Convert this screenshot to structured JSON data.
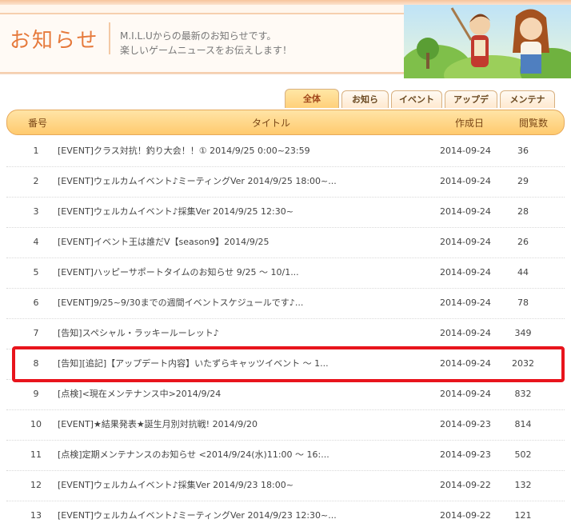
{
  "header": {
    "title": "お知らせ",
    "subtitle_line1": "M.I.L.Uからの最新のお知らせです。",
    "subtitle_line2": "楽しいゲームニュースをお伝えします！"
  },
  "tabs": [
    {
      "label": "全体",
      "active": true
    },
    {
      "label": "お知らせ",
      "active": false
    },
    {
      "label": "イベント",
      "active": false
    },
    {
      "label": "アップデート",
      "active": false
    },
    {
      "label": "メンテナンス",
      "active": false
    }
  ],
  "table": {
    "columns": {
      "no": "番号",
      "title": "タイトル",
      "date": "作成日",
      "views": "閲覧数"
    },
    "rows": [
      {
        "no": "1",
        "title": "[EVENT]クラス対抗！釣り大会！！① 2014/9/25 0:00~23:59",
        "date": "2014-09-24",
        "views": "36"
      },
      {
        "no": "2",
        "title": "[EVENT]ウェルカムイベント♪ミーティングVer 2014/9/25 18:00~...",
        "date": "2014-09-24",
        "views": "29"
      },
      {
        "no": "3",
        "title": "[EVENT]ウェルカムイベント♪採集Ver 2014/9/25 12:30~",
        "date": "2014-09-24",
        "views": "28"
      },
      {
        "no": "4",
        "title": "[EVENT]イベント王は誰だV【season9】2014/9/25",
        "date": "2014-09-24",
        "views": "26"
      },
      {
        "no": "5",
        "title": "[EVENT]ハッピーサポートタイムのお知らせ 9/25 ～ 10/1...",
        "date": "2014-09-24",
        "views": "44"
      },
      {
        "no": "6",
        "title": "[EVENT]9/25~9/30までの週間イベントスケジュールです♪...",
        "date": "2014-09-24",
        "views": "78"
      },
      {
        "no": "7",
        "title": "[告知]スペシャル・ラッキールーレット♪",
        "date": "2014-09-24",
        "views": "349"
      },
      {
        "no": "8",
        "title": "[告知][追記]【アップデート内容】いたずらキャッツイベント ～ 1...",
        "date": "2014-09-24",
        "views": "2032"
      },
      {
        "no": "9",
        "title": "[点検]<現在メンテナンス中>2014/9/24",
        "date": "2014-09-24",
        "views": "832"
      },
      {
        "no": "10",
        "title": "[EVENT]★結果発表★誕生月別対抗戦! 2014/9/20",
        "date": "2014-09-23",
        "views": "814"
      },
      {
        "no": "11",
        "title": "[点検]定期メンテナンスのお知らせ <2014/9/24(水)11:00 ～ 16:...",
        "date": "2014-09-23",
        "views": "502"
      },
      {
        "no": "12",
        "title": "[EVENT]ウェルカムイベント♪採集Ver 2014/9/23 18:00~",
        "date": "2014-09-22",
        "views": "132"
      },
      {
        "no": "13",
        "title": "[EVENT]ウェルカムイベント♪ミーティングVer 2014/9/23 12:30~...",
        "date": "2014-09-22",
        "views": "121"
      }
    ]
  },
  "highlighted_row": "8",
  "colors": {
    "accent": "#e67a3c",
    "header_band": "#ffca6e",
    "highlight_border": "#e8141c"
  }
}
